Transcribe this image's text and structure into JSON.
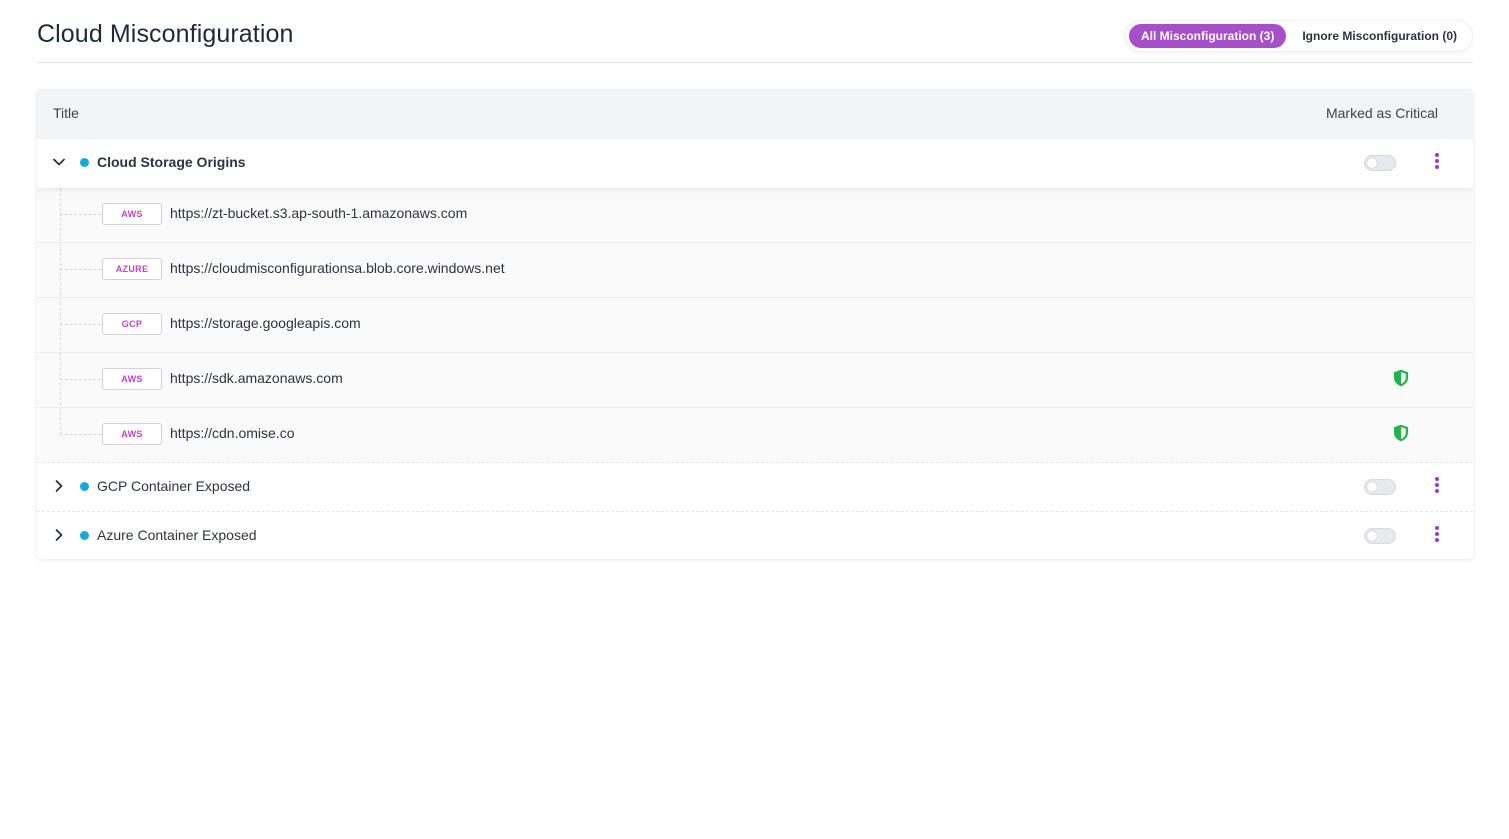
{
  "header": {
    "title": "Cloud Misconfiguration",
    "tabs": [
      {
        "label": "All Misconfiguration (3)",
        "active": true
      },
      {
        "label": "Ignore Misconfiguration (0)",
        "active": false
      }
    ]
  },
  "table": {
    "columns": {
      "title": "Title",
      "critical": "Marked as Critical"
    },
    "groups": [
      {
        "title": "Cloud Storage Origins",
        "expanded": true,
        "critical": false,
        "children": [
          {
            "provider": "AWS",
            "url": "https://zt-bucket.s3.ap-south-1.amazonaws.com",
            "shield": false
          },
          {
            "provider": "AZURE",
            "url": "https://cloudmisconfigurationsa.blob.core.windows.net",
            "shield": false
          },
          {
            "provider": "GCP",
            "url": "https://storage.googleapis.com",
            "shield": false
          },
          {
            "provider": "AWS",
            "url": "https://sdk.amazonaws.com",
            "shield": true
          },
          {
            "provider": "AWS",
            "url": "https://cdn.omise.co",
            "shield": true
          }
        ]
      },
      {
        "title": "GCP Container Exposed",
        "expanded": false,
        "critical": false
      },
      {
        "title": "Azure Container Exposed",
        "expanded": false,
        "critical": false
      }
    ]
  },
  "colors": {
    "accent": "#a64fc9",
    "status_dot": "#17a9d6",
    "badge_text": "#c242cf",
    "shield": "#22b24c"
  },
  "icons": {
    "expand": "chevron-down-icon",
    "collapse": "chevron-right-icon",
    "menu": "kebab-menu-icon",
    "verified": "shield-check-icon"
  }
}
